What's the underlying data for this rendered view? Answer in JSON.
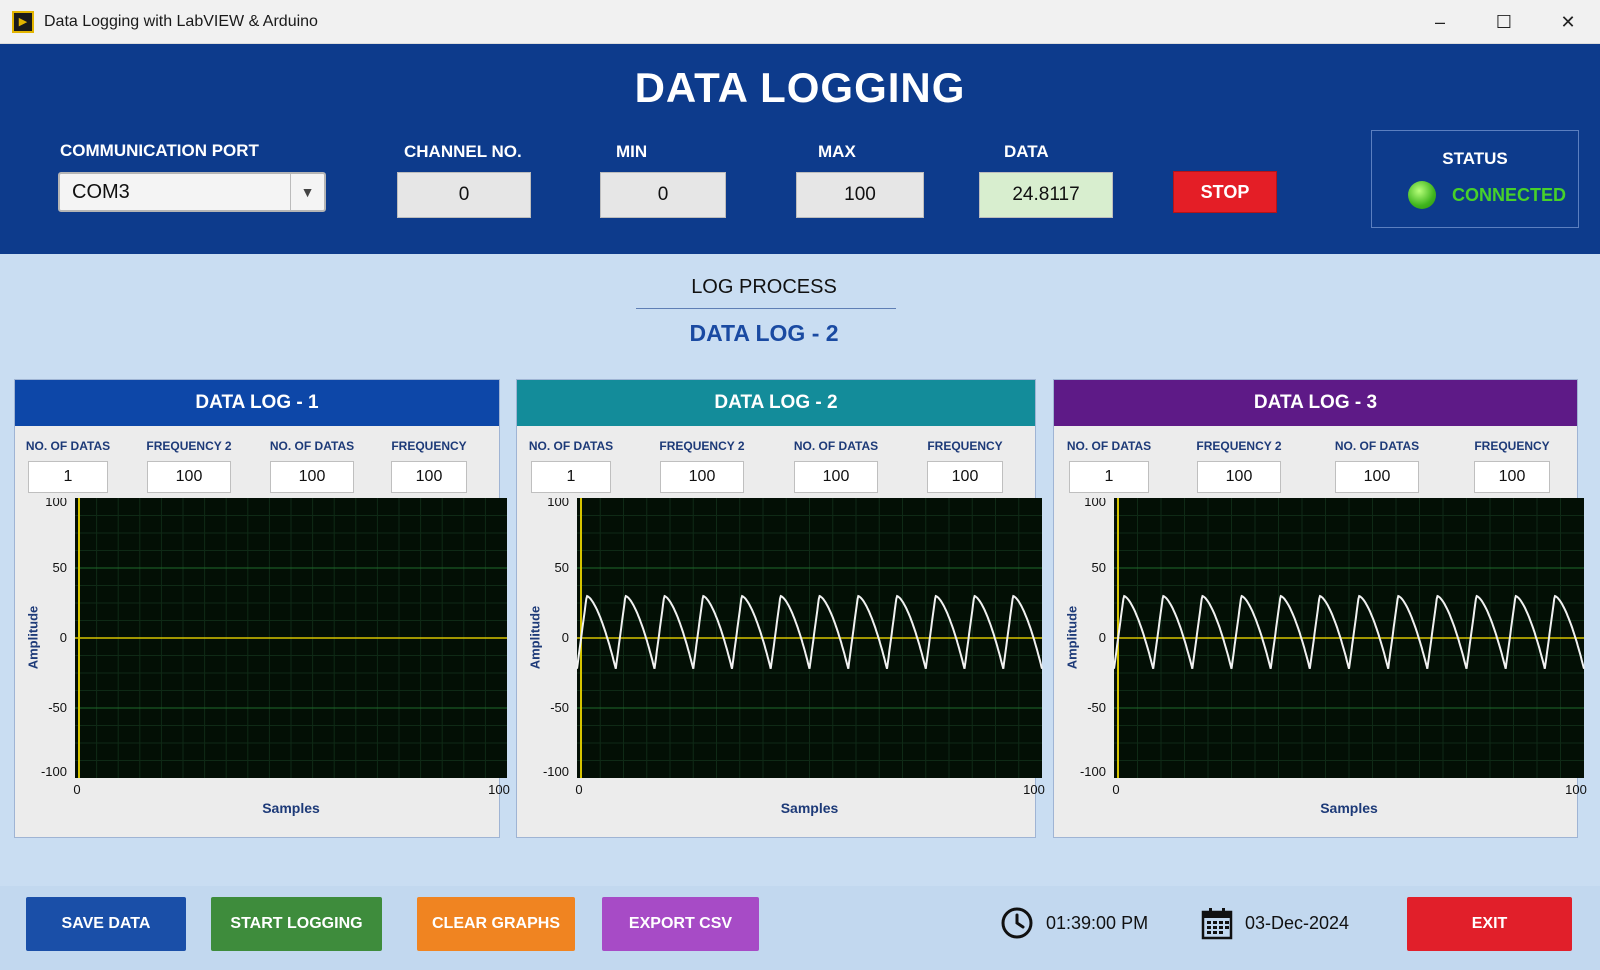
{
  "window": {
    "title": "Data Logging with LabVIEW & Arduino",
    "minimize": "–",
    "maximize": "☐",
    "close": "✕"
  },
  "header": {
    "title": "DATA LOGGING",
    "comm_port": {
      "label": "COMMUNICATION PORT",
      "value": "COM3"
    },
    "channel": {
      "label": "CHANNEL NO.",
      "value": "0"
    },
    "min": {
      "label": "MIN",
      "value": "0"
    },
    "max": {
      "label": "MAX",
      "value": "100"
    },
    "data": {
      "label": "DATA",
      "value": "24.8117"
    },
    "stop_label": "STOP",
    "status": {
      "label": "STATUS",
      "value": "CONNECTED",
      "led_color": "#3fb51e"
    }
  },
  "log_process": {
    "label": "LOG PROCESS",
    "value": "DATA LOG - 2"
  },
  "panels": [
    {
      "title": "DATA LOG - 1",
      "color": "#0d47a8",
      "field_labels": [
        "NO. OF DATAS",
        "FREQUENCY 2",
        "NO. OF DATAS",
        "FREQUENCY"
      ],
      "field_values": [
        "1",
        "100",
        "100",
        "100"
      ],
      "y_axis_label": "Amplitude",
      "x_axis_label": "Samples",
      "y_ticks": [
        "100",
        "50",
        "0",
        "-50",
        "-100"
      ],
      "x_ticks": [
        "0",
        "100"
      ]
    },
    {
      "title": "DATA LOG - 2",
      "color": "#138c9a",
      "field_labels": [
        "NO. OF DATAS",
        "FREQUENCY 2",
        "NO. OF DATAS",
        "FREQUENCY"
      ],
      "field_values": [
        "1",
        "100",
        "100",
        "100"
      ],
      "y_axis_label": "Amplitude",
      "x_axis_label": "Samples",
      "y_ticks": [
        "100",
        "50",
        "0",
        "-50",
        "-100"
      ],
      "x_ticks": [
        "0",
        "100"
      ]
    },
    {
      "title": "DATA LOG - 3",
      "color": "#5e1a87",
      "field_labels": [
        "NO. OF DATAS",
        "FREQUENCY 2",
        "NO. OF DATAS",
        "FREQUENCY"
      ],
      "field_values": [
        "1",
        "100",
        "100",
        "100"
      ],
      "y_axis_label": "Amplitude",
      "x_axis_label": "Samples",
      "y_ticks": [
        "100",
        "50",
        "0",
        "-50",
        "-100"
      ],
      "x_ticks": [
        "0",
        "100"
      ]
    }
  ],
  "chart_data": [
    {
      "type": "line",
      "xlim": [
        0,
        100
      ],
      "ylim": [
        -100,
        100
      ],
      "grid": true,
      "series": [
        {
          "values": "flat",
          "color": "#e8d200"
        }
      ]
    },
    {
      "type": "line",
      "xlim": [
        0,
        100
      ],
      "ylim": [
        -100,
        100
      ],
      "grid": true,
      "series": [
        {
          "color": "#f2f2f2",
          "waveform": "periodic",
          "cycles": 12,
          "max": 30,
          "min": -22
        }
      ]
    },
    {
      "type": "line",
      "xlim": [
        0,
        100
      ],
      "ylim": [
        -100,
        100
      ],
      "grid": true,
      "series": [
        {
          "color": "#f2f2f2",
          "waveform": "periodic",
          "cycles": 12,
          "max": 30,
          "min": -22
        }
      ]
    }
  ],
  "footer": {
    "save_label": "SAVE DATA",
    "save_color": "#1a4fa8",
    "start_label": "START LOGGING",
    "start_color": "#3e8c3c",
    "clear_label": "CLEAR GRAPHS",
    "clear_color": "#f08421",
    "export_label": "EXPORT CSV",
    "export_color": "#a74bc6",
    "time": "01:39:00 PM",
    "date": "03-Dec-2024",
    "exit_label": "EXIT",
    "exit_color": "#e11f2a",
    "clock_icon": "clock-icon",
    "calendar_icon": "calendar-icon"
  }
}
